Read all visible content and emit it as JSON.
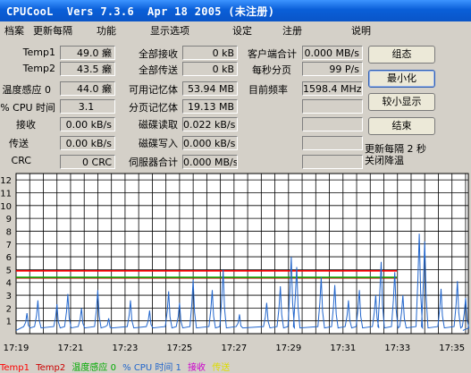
{
  "window": {
    "title": "CPUCooL  Vers 7.3.6  Apr 18 2005 (未注册)"
  },
  "menu": [
    "档案",
    "更新每隔",
    "功能",
    "显示选项",
    "设定",
    "注册",
    "说明"
  ],
  "col1": [
    {
      "label": "Temp1",
      "value": "49.0 癞"
    },
    {
      "label": "Temp2",
      "value": "43.5 癞"
    },
    {
      "label": "温度感应 0",
      "value": "44.0 癞"
    },
    {
      "label": "% CPU 时间",
      "value": "3.1"
    },
    {
      "label": "接收",
      "value": "0.00 kB/s"
    },
    {
      "label": "传送",
      "value": "0.00 kB/s"
    },
    {
      "label": "CRC",
      "value": "0 CRC"
    }
  ],
  "col2": [
    {
      "label": "全部接收",
      "value": "0 kB"
    },
    {
      "label": "全部传送",
      "value": "0 kB"
    },
    {
      "label": "可用记忆体",
      "value": "53.94 MB"
    },
    {
      "label": "分页记忆体",
      "value": "19.13 MB"
    },
    {
      "label": "磁碟读取",
      "value": "0.022 kB/s"
    },
    {
      "label": "磁碟写入",
      "value": "0.000 kB/s"
    },
    {
      "label": "伺服器合计",
      "value": "0.000 MB/s"
    }
  ],
  "col3": [
    {
      "label": "客户端合计",
      "value": "0.000 MB/s"
    },
    {
      "label": "每秒分页",
      "value": "99 P/s"
    },
    {
      "label": "目前频率",
      "value": "1598.4 MHz"
    },
    {
      "label": "",
      "value": ""
    },
    {
      "label": "",
      "value": ""
    },
    {
      "label": "",
      "value": ""
    },
    {
      "label": "",
      "value": ""
    }
  ],
  "buttons": {
    "dock": "组态",
    "minimize": "最小化",
    "compact": "较小显示",
    "exit": "结束"
  },
  "status": {
    "update": "更新每隔 2 秒",
    "cooling": "关闭降温"
  },
  "colors": {
    "temp1": "#ff0000",
    "temp2": "#cc0000",
    "sensor": "#00aa00",
    "cpu": "#2266cc",
    "recv": "#cc00cc",
    "send": "#dddd00",
    "grid": "#000000",
    "plot_bg": "#ffffff"
  },
  "chart_data": {
    "type": "line",
    "title": "",
    "xlabel": "",
    "ylabel": "",
    "ylim": [
      0,
      12.5
    ],
    "yticks": [
      1,
      2,
      3,
      4,
      5,
      6,
      7,
      8,
      9,
      10,
      11,
      12
    ],
    "xticks": [
      "17:19",
      "17:21",
      "17:23",
      "17:25",
      "17:27",
      "17:29",
      "17:31",
      "17:33",
      "17:35"
    ],
    "xlim_minutes": [
      0,
      16.6
    ],
    "grid": true,
    "legend": [
      "Temp1",
      "Temp2",
      "温度感应 0",
      "% CPU 时间 1",
      "接收",
      "传送"
    ],
    "series": [
      {
        "name": "Temp1",
        "color": "#ff0000",
        "constant": 4.9
      },
      {
        "name": "Temp2",
        "color": "#cc0000",
        "constant": 4.35
      },
      {
        "name": "温度感应 0",
        "color": "#00aa00",
        "constant": 4.4
      },
      {
        "name": "% CPU 时间 1",
        "color": "#2266cc",
        "spikes": [
          [
            0.4,
            1.6
          ],
          [
            0.8,
            2.6
          ],
          [
            1.5,
            2.3
          ],
          [
            1.9,
            3.1
          ],
          [
            2.4,
            2.0
          ],
          [
            3.0,
            3.4
          ],
          [
            3.4,
            1.2
          ],
          [
            4.2,
            2.6
          ],
          [
            4.9,
            1.8
          ],
          [
            5.6,
            3.3
          ],
          [
            6.0,
            2.4
          ],
          [
            6.5,
            4.2
          ],
          [
            7.2,
            3.4
          ],
          [
            7.6,
            5.0
          ],
          [
            8.2,
            1.5
          ],
          [
            9.2,
            2.4
          ],
          [
            9.7,
            3.7
          ],
          [
            10.1,
            6.0
          ],
          [
            10.3,
            5.2
          ],
          [
            11.2,
            4.4
          ],
          [
            11.7,
            3.8
          ],
          [
            12.2,
            2.6
          ],
          [
            12.6,
            3.4
          ],
          [
            13.2,
            3.0
          ],
          [
            13.4,
            5.6
          ],
          [
            13.9,
            4.8
          ],
          [
            14.2,
            3.0
          ],
          [
            14.8,
            7.8
          ],
          [
            15.0,
            7.2
          ],
          [
            15.6,
            3.5
          ],
          [
            16.2,
            4.1
          ],
          [
            16.5,
            2.8
          ]
        ],
        "baseline": 0.25
      }
    ]
  }
}
